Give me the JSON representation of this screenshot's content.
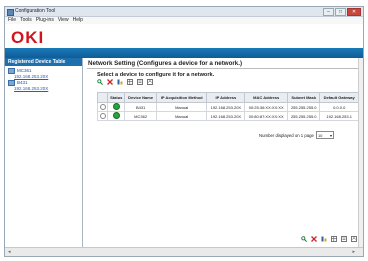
{
  "window": {
    "title": "Configuration Tool"
  },
  "menubar": {
    "items": [
      "File",
      "Tools",
      "Plug-ins",
      "View",
      "Help"
    ]
  },
  "brand": {
    "logo_text": "OKI",
    "accent": "#d2141e",
    "bar_color": "#1a79b8"
  },
  "sidebar": {
    "heading": "Registered Device Table",
    "devices": [
      {
        "name": "MC361",
        "address": "192.168.253.20X"
      },
      {
        "name": "B431",
        "address": "192.168.253.20X"
      }
    ]
  },
  "main": {
    "title": "Network Setting (Configures a device for a network.)",
    "instruction": "Select a device to configure it for a network.",
    "columns": [
      "",
      "Status",
      "Device Name",
      "IP Acquisition Method",
      "IP Address",
      "MAC Address",
      "Subnet Mask",
      "Default Gateway"
    ],
    "rows": [
      {
        "status": "online",
        "device_name": "B431",
        "method": "Manual",
        "ip": "192.168.253.20X",
        "mac": "00:25:36:XX:XX:XX",
        "subnet": "255.255.255.0",
        "gateway": "0.0.0.0"
      },
      {
        "status": "online",
        "device_name": "MC362",
        "method": "Manual",
        "ip": "192.168.253.20X",
        "mac": "00:80:87:XX:XX:XX",
        "subnet": "255.255.255.0",
        "gateway": "192.168.253.1"
      }
    ],
    "per_page_label": "Number displayed on 1 page",
    "per_page_value": "10"
  }
}
